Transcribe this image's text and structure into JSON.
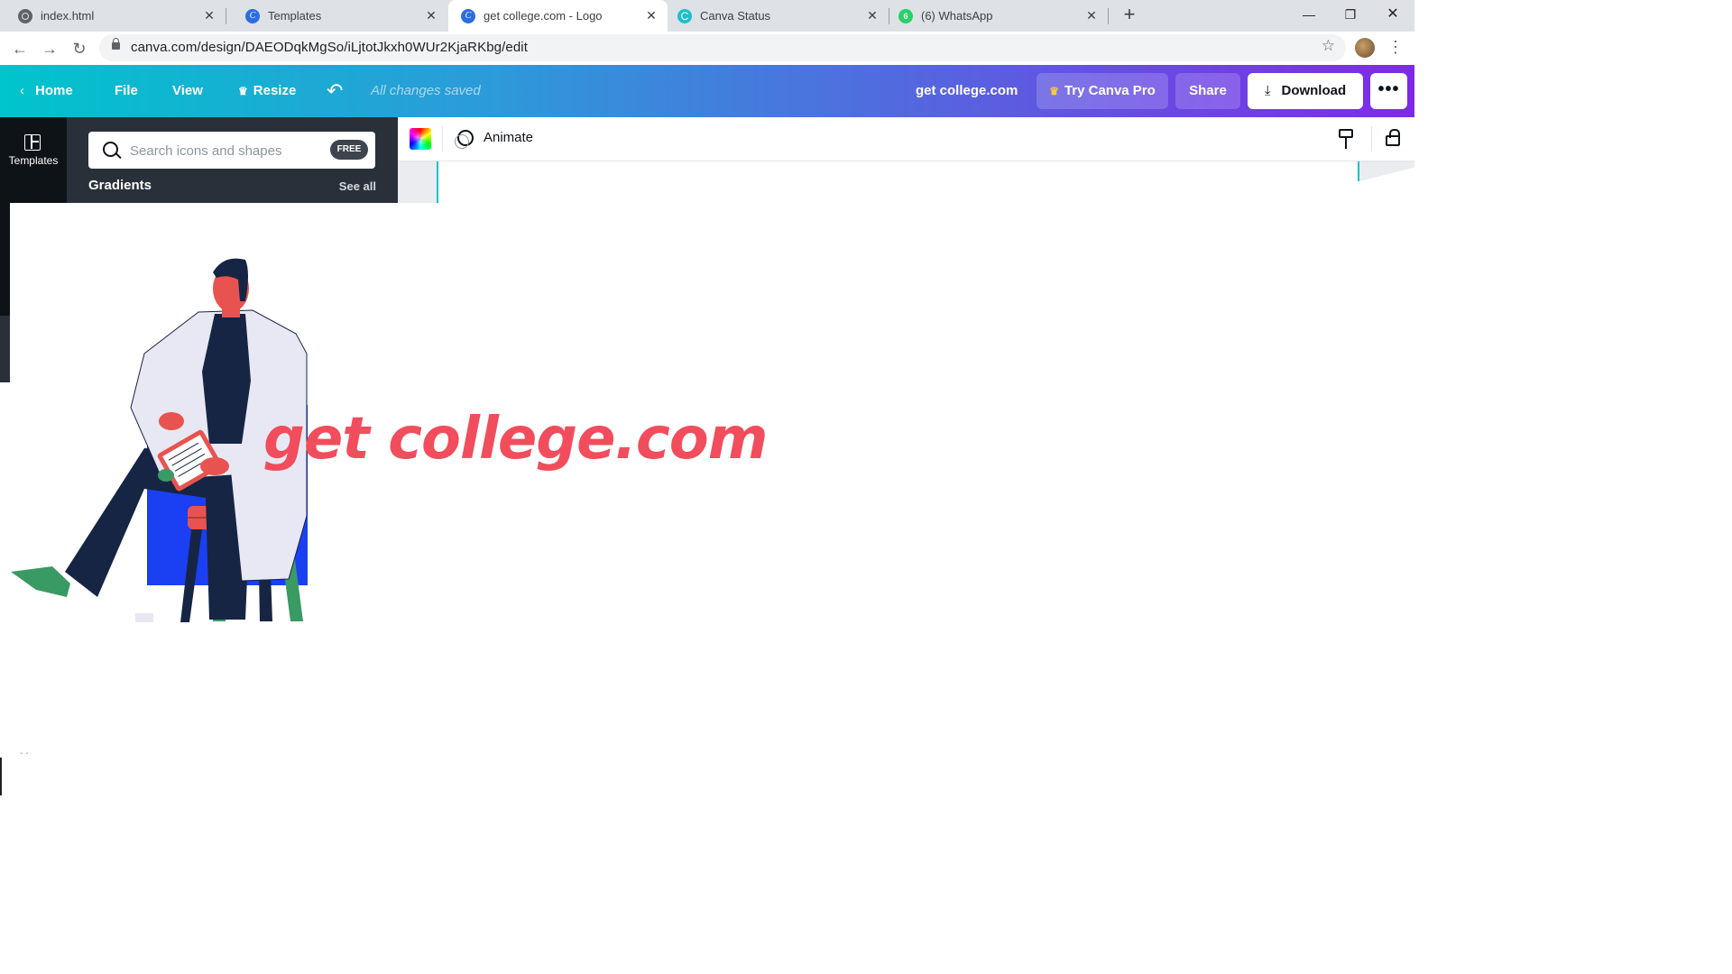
{
  "browser": {
    "tabs": [
      {
        "title": "index.html",
        "favicon": "globe-icon",
        "active": false
      },
      {
        "title": "Templates",
        "favicon": "canva-icon",
        "active": false
      },
      {
        "title": "get college.com - Logo",
        "favicon": "canva-icon",
        "active": true
      },
      {
        "title": "Canva Status",
        "favicon": "canva-status-icon",
        "active": false
      },
      {
        "title": "(6) WhatsApp",
        "favicon": "whatsapp-icon",
        "active": false
      }
    ],
    "url": "canva.com/design/DAEODqkMgSo/iLjtotJkxh0WUr2KjaRKbg/edit"
  },
  "header": {
    "home_label": "Home",
    "file_label": "File",
    "view_label": "View",
    "resize_label": "Resize",
    "saved_status": "All changes saved",
    "design_title": "get college.com",
    "try_pro_label": "Try Canva Pro",
    "share_label": "Share",
    "download_label": "Download",
    "more_label": "•••",
    "brand_gradient": [
      "#00c4cc",
      "#7d2ae8"
    ]
  },
  "rail": {
    "templates_label": "Templates"
  },
  "panel": {
    "search_placeholder": "Search icons and shapes",
    "free_badge": "FREE",
    "section_title": "Gradients",
    "see_all_label": "See all"
  },
  "toolbar": {
    "animate_label": "Animate"
  },
  "canvas": {
    "logo_text": "get college.com",
    "logo_color": "#f14d5d",
    "illustration": "doctor-seated-on-stool-illustration",
    "bottom_marker": "- -"
  }
}
